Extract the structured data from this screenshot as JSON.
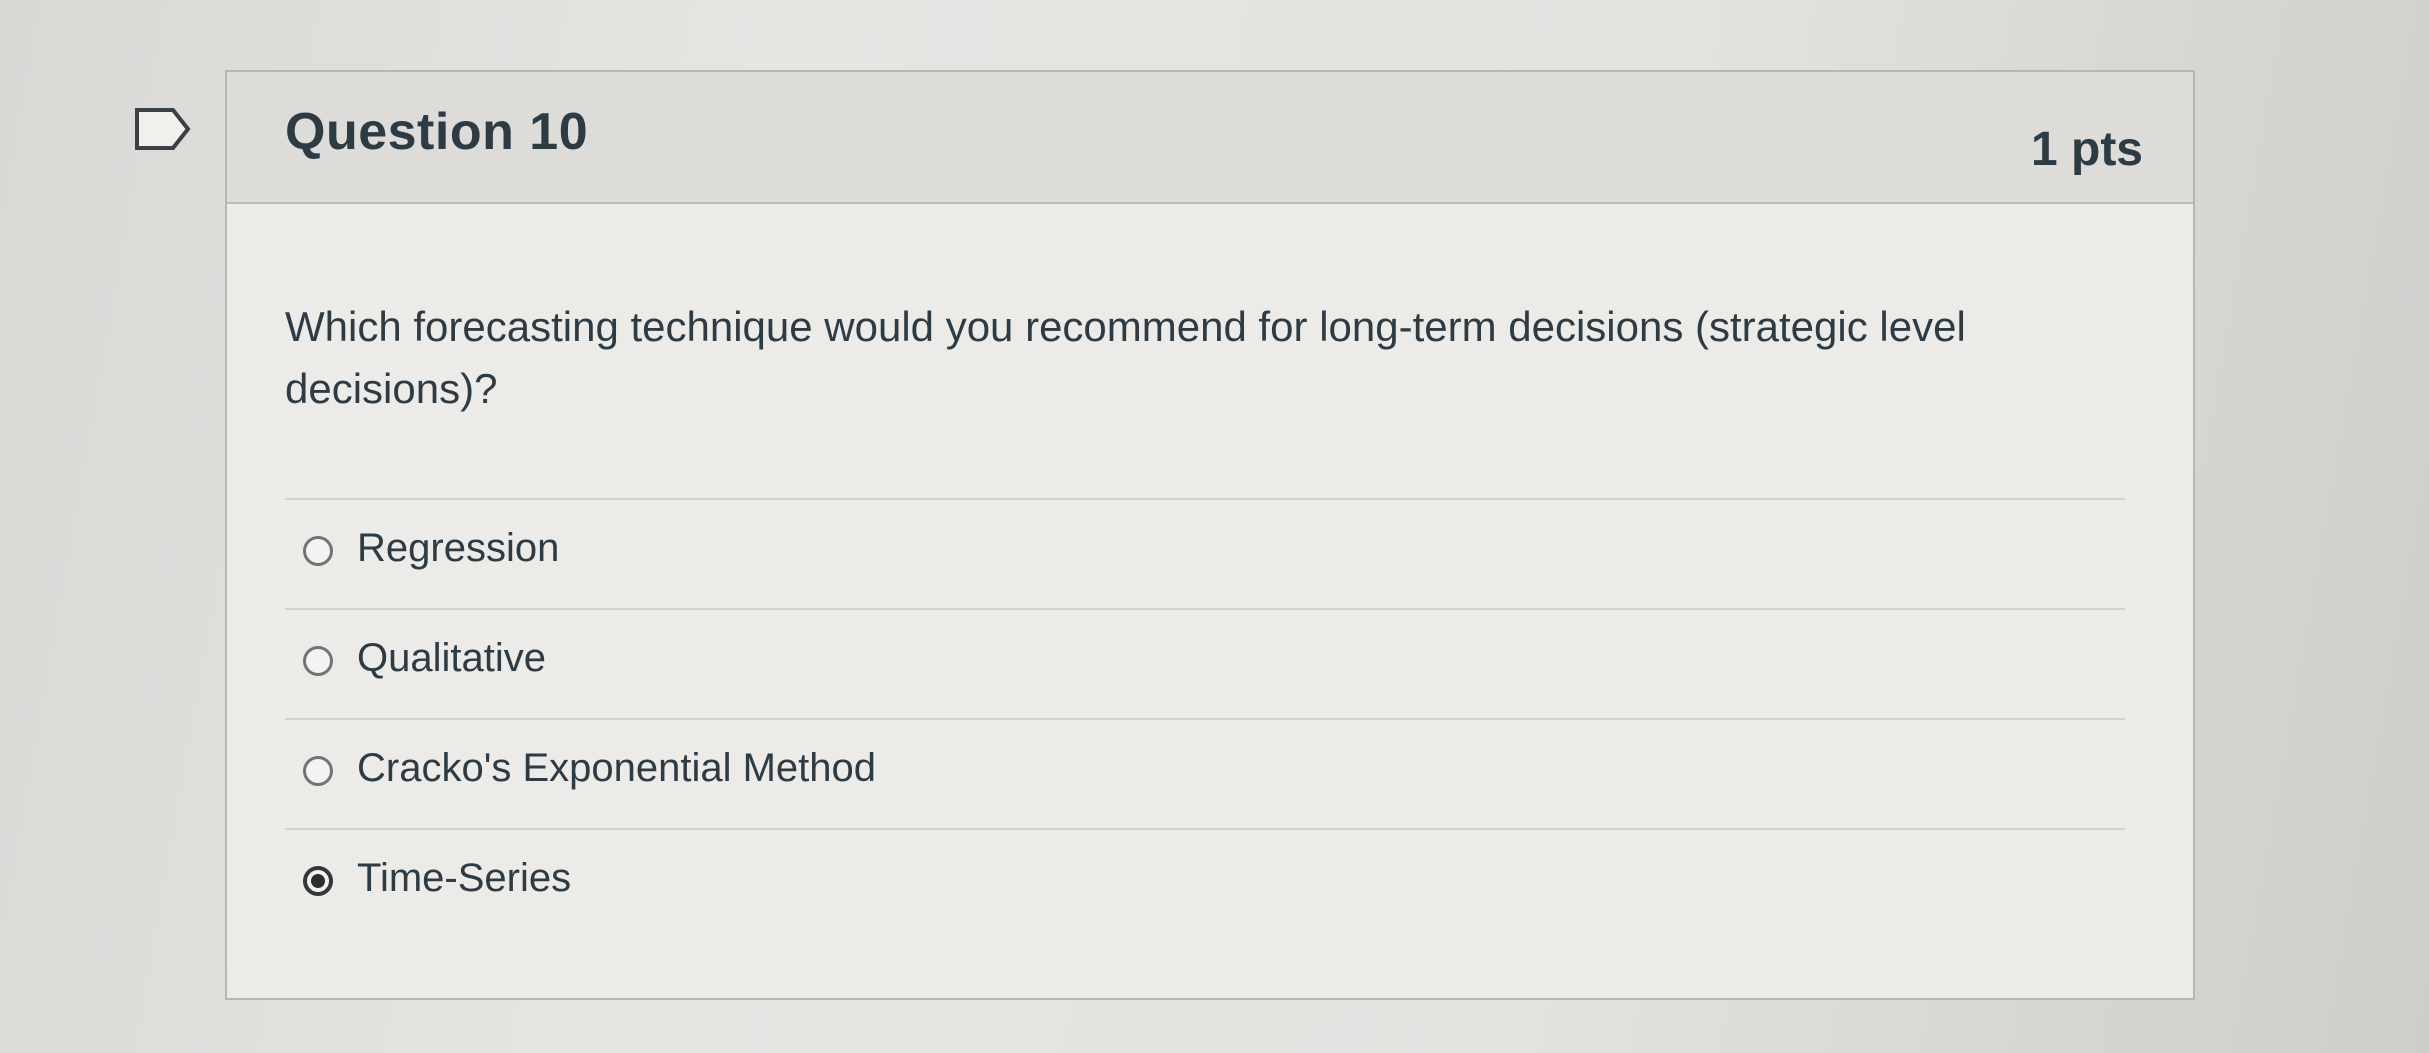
{
  "question": {
    "title": "Question 10",
    "points": "1 pts",
    "text": "Which forecasting technique would you recommend for long-term decisions (strategic level decisions)?",
    "flag_icon": "bookmark-flag-icon"
  },
  "answers": [
    {
      "label": "Regression",
      "selected": false
    },
    {
      "label": "Qualitative",
      "selected": false
    },
    {
      "label": "Cracko's Exponential Method",
      "selected": false
    },
    {
      "label": "Time-Series",
      "selected": true
    }
  ],
  "colors": {
    "text": "#2d3b45",
    "header_bg": "#dddcd8",
    "card_border": "#b7b6b2"
  }
}
